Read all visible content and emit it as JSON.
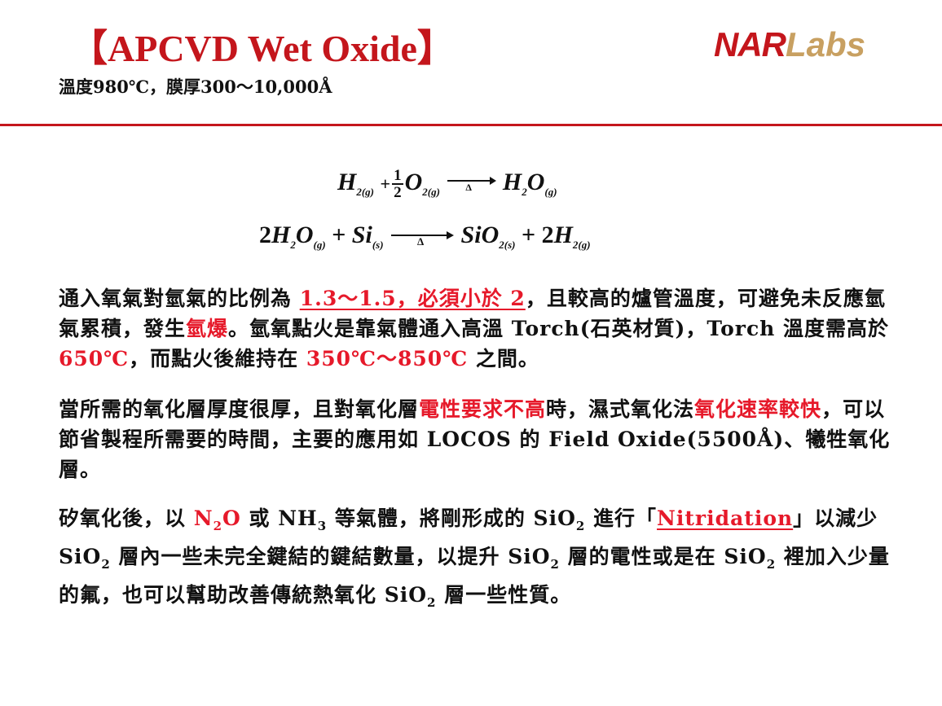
{
  "header": {
    "title": "【APCVD Wet Oxide】",
    "subtitle": "溫度980℃，膜厚300～10,000Å",
    "logo": {
      "nar": "NAR",
      "labs": "Labs",
      "nar_color": "#c4161c",
      "labs_color": "#c8a061"
    }
  },
  "colors": {
    "accent_red": "#e6192a",
    "rule": "#c4161c"
  },
  "equations": {
    "eq1": {
      "h": "H",
      "h_sub": "2(g)",
      "plus": "+",
      "frac_num": "1",
      "frac_den": "2",
      "o": "O",
      "o_sub": "2(g)",
      "delta": "Δ",
      "prod": "H",
      "prod_sub1": "2",
      "prod_o": "O",
      "prod_sub2": "(g)"
    },
    "eq2": {
      "coef": "2",
      "h": "H",
      "h_sub": "2",
      "o": "O",
      "o_sub": "(g)",
      "plus": "+",
      "si": "Si",
      "si_sub": "(s)",
      "delta": "Δ",
      "prod": "SiO",
      "prod_sub": "2(s)",
      "plus2": "+",
      "coef2": "2",
      "h2": "H",
      "h2_sub": "2(g)"
    }
  },
  "para1": {
    "t1": "通入氧氣對氫氣的比例為 ",
    "red1": "1.3～1.5，必須小於 2",
    "t2": "，且較高的爐管溫度，可避免未反應氫氣累積，發生",
    "red2": "氫爆",
    "t3": "。氫氧點火是靠氣體通入高溫 Torch(石英材質)，Torch 溫度需高於 ",
    "red3": "650℃",
    "t4": "，而點火後維持在 ",
    "red4": "350℃～850℃",
    "t5": " 之間。"
  },
  "para2": {
    "t1": "當所需的氧化層厚度很厚，且對氧化層",
    "red1": "電性要求不高",
    "t2": "時，濕式氧化法",
    "red2": "氧化速率較快",
    "t3": "，可以節省製程所需要的時間，主要的應用如 LOCOS 的 Field Oxide(5500Å)、犧牲氧化層。"
  },
  "para3": {
    "t1": "矽氧化後，以 ",
    "red_n": "N",
    "red_n_sub": "2",
    "red_o": "O",
    "t2": " 或 NH",
    "nh_sub": "3",
    "t3": " 等氣體，將剛形成的 SiO",
    "s1": "2",
    "t4": " 進行「",
    "red2": "Nitridation",
    "t5": "」以減少 SiO",
    "s2": "2",
    "t6": " 層內一些未完全鍵結的鍵結數量，以提升 SiO",
    "s3": "2",
    "t7": " 層的電性或是在 SiO",
    "s4": "2",
    "t8": " 裡加入少量的氟，也可以幫助改善傳統熱氧化 SiO",
    "s5": "2",
    "t9": " 層一些性質。"
  }
}
